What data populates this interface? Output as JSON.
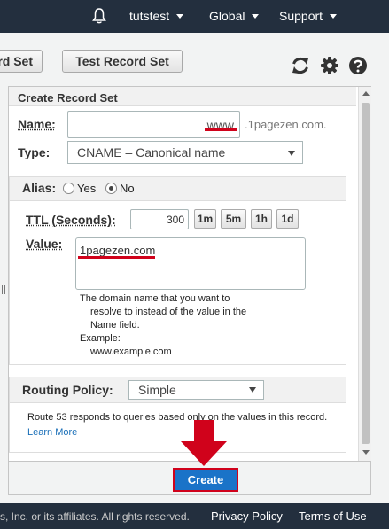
{
  "topnav": {
    "account": "tutstest",
    "region": "Global",
    "support": "Support"
  },
  "toolbar": {
    "cut_button_label": "rd Set",
    "test_button_label": "Test Record Set"
  },
  "panel": {
    "title": "Create Record Set",
    "name_label": "Name:",
    "name_value": "www",
    "domain_suffix": ".1pagezen.com.",
    "type_label": "Type:",
    "type_value": "CNAME – Canonical name",
    "alias_label": "Alias:",
    "alias_yes": "Yes",
    "alias_no": "No",
    "alias_selected": "No",
    "ttl_label": "TTL (Seconds):",
    "ttl_value": "300",
    "ttl_buttons": [
      "1m",
      "5m",
      "1h",
      "1d"
    ],
    "value_label": "Value:",
    "value_text": "1pagezen.com",
    "help_text": [
      "The domain name that you want to",
      "resolve to instead of the value in the",
      "Name field.",
      "Example:",
      "www.example.com"
    ],
    "routing_label": "Routing Policy:",
    "routing_value": "Simple",
    "routing_desc": "Route 53 responds to queries based only on the values in this record.",
    "learn_more": "Learn More"
  },
  "create_label": "Create",
  "footer": {
    "copyright": "s, Inc. or its affiliates. All rights reserved.",
    "privacy": "Privacy Policy",
    "terms": "Terms of Use"
  },
  "colors": {
    "nav_bg": "#232f3e",
    "primary": "#1a73c8",
    "highlight_red": "#d0021b"
  }
}
